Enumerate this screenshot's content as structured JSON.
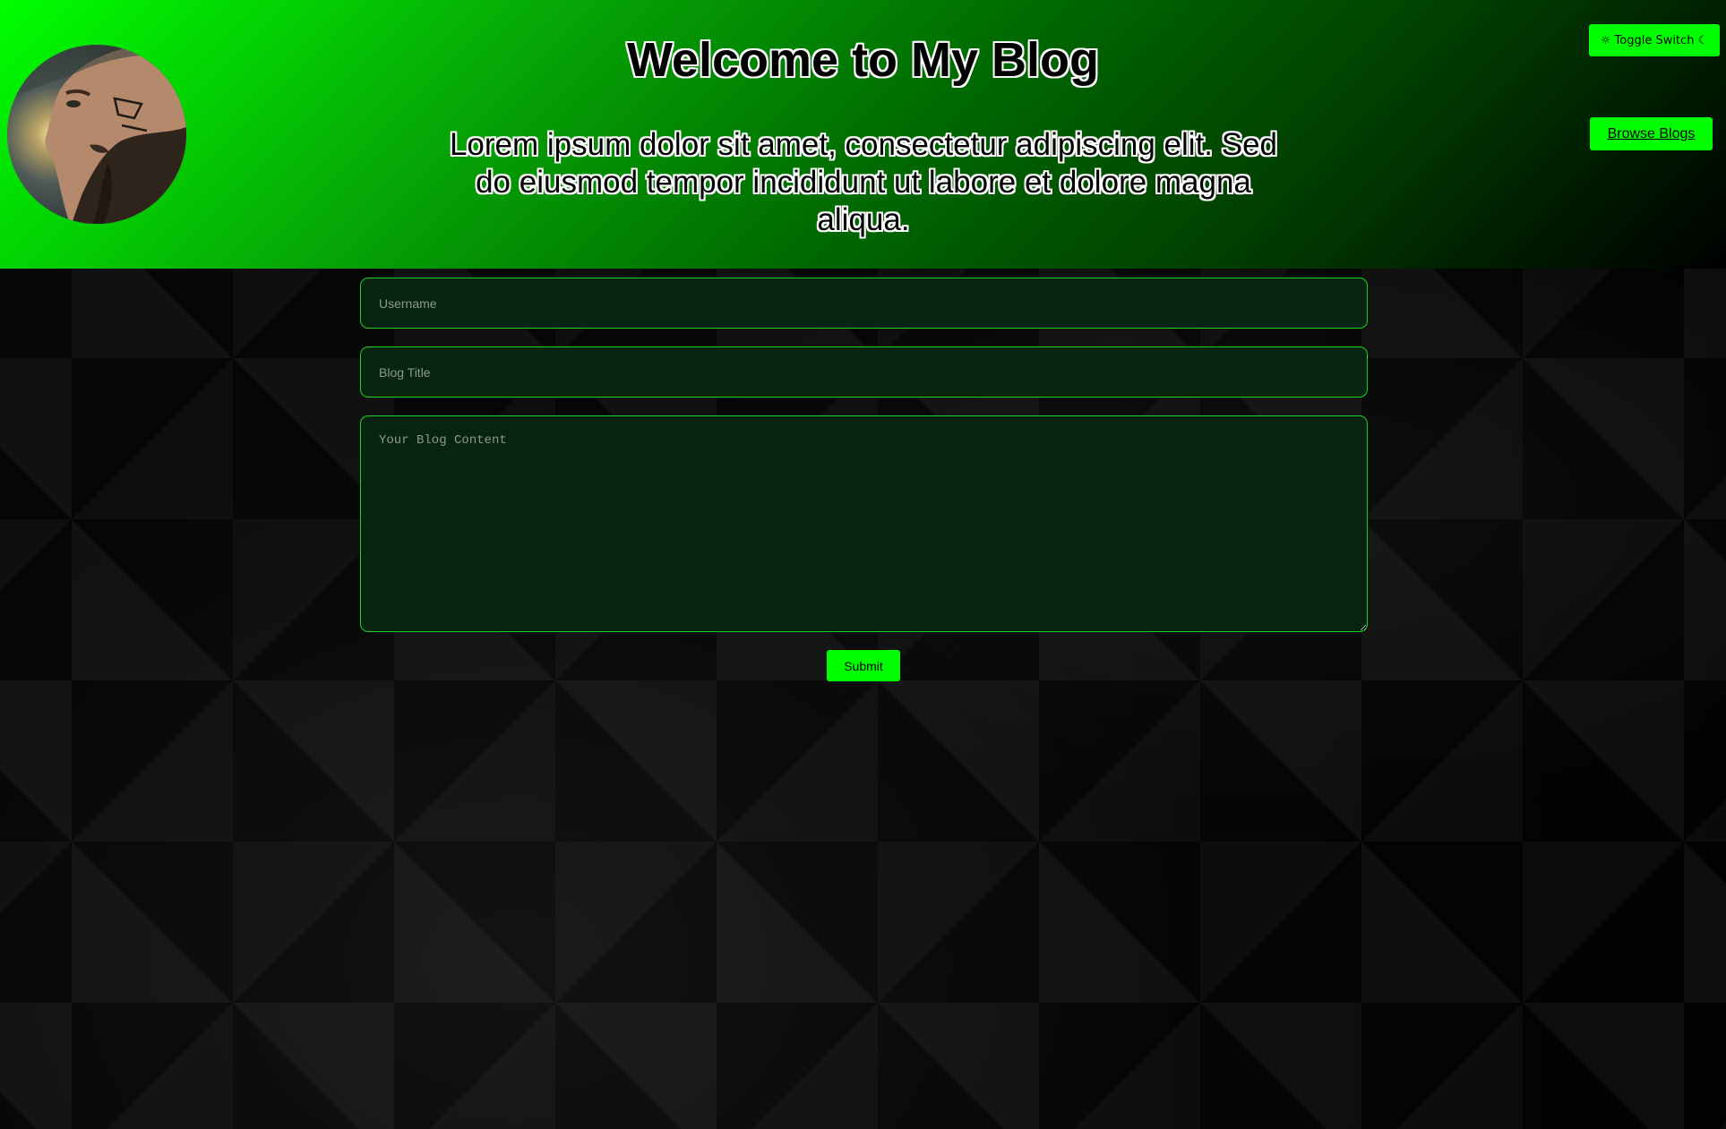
{
  "header": {
    "title": "Welcome to My Blog",
    "intro": "Lorem ipsum dolor sit amet, consectetur adipiscing elit. Sed do eiusmod tempor incididunt ut labore et dolore magna aliqua.",
    "avatar_icon": "bearded-man-portrait"
  },
  "controls": {
    "toggle_label": "☼ Toggle Switch ☾",
    "browse_label": "Browse Blogs"
  },
  "form": {
    "username_placeholder": "Username",
    "title_placeholder": "Blog Title",
    "content_placeholder": "Your Blog Content",
    "submit_label": "Submit"
  },
  "colors": {
    "accent": "#00ff00",
    "field_background": "#06240f",
    "field_border": "#1fd21f"
  }
}
